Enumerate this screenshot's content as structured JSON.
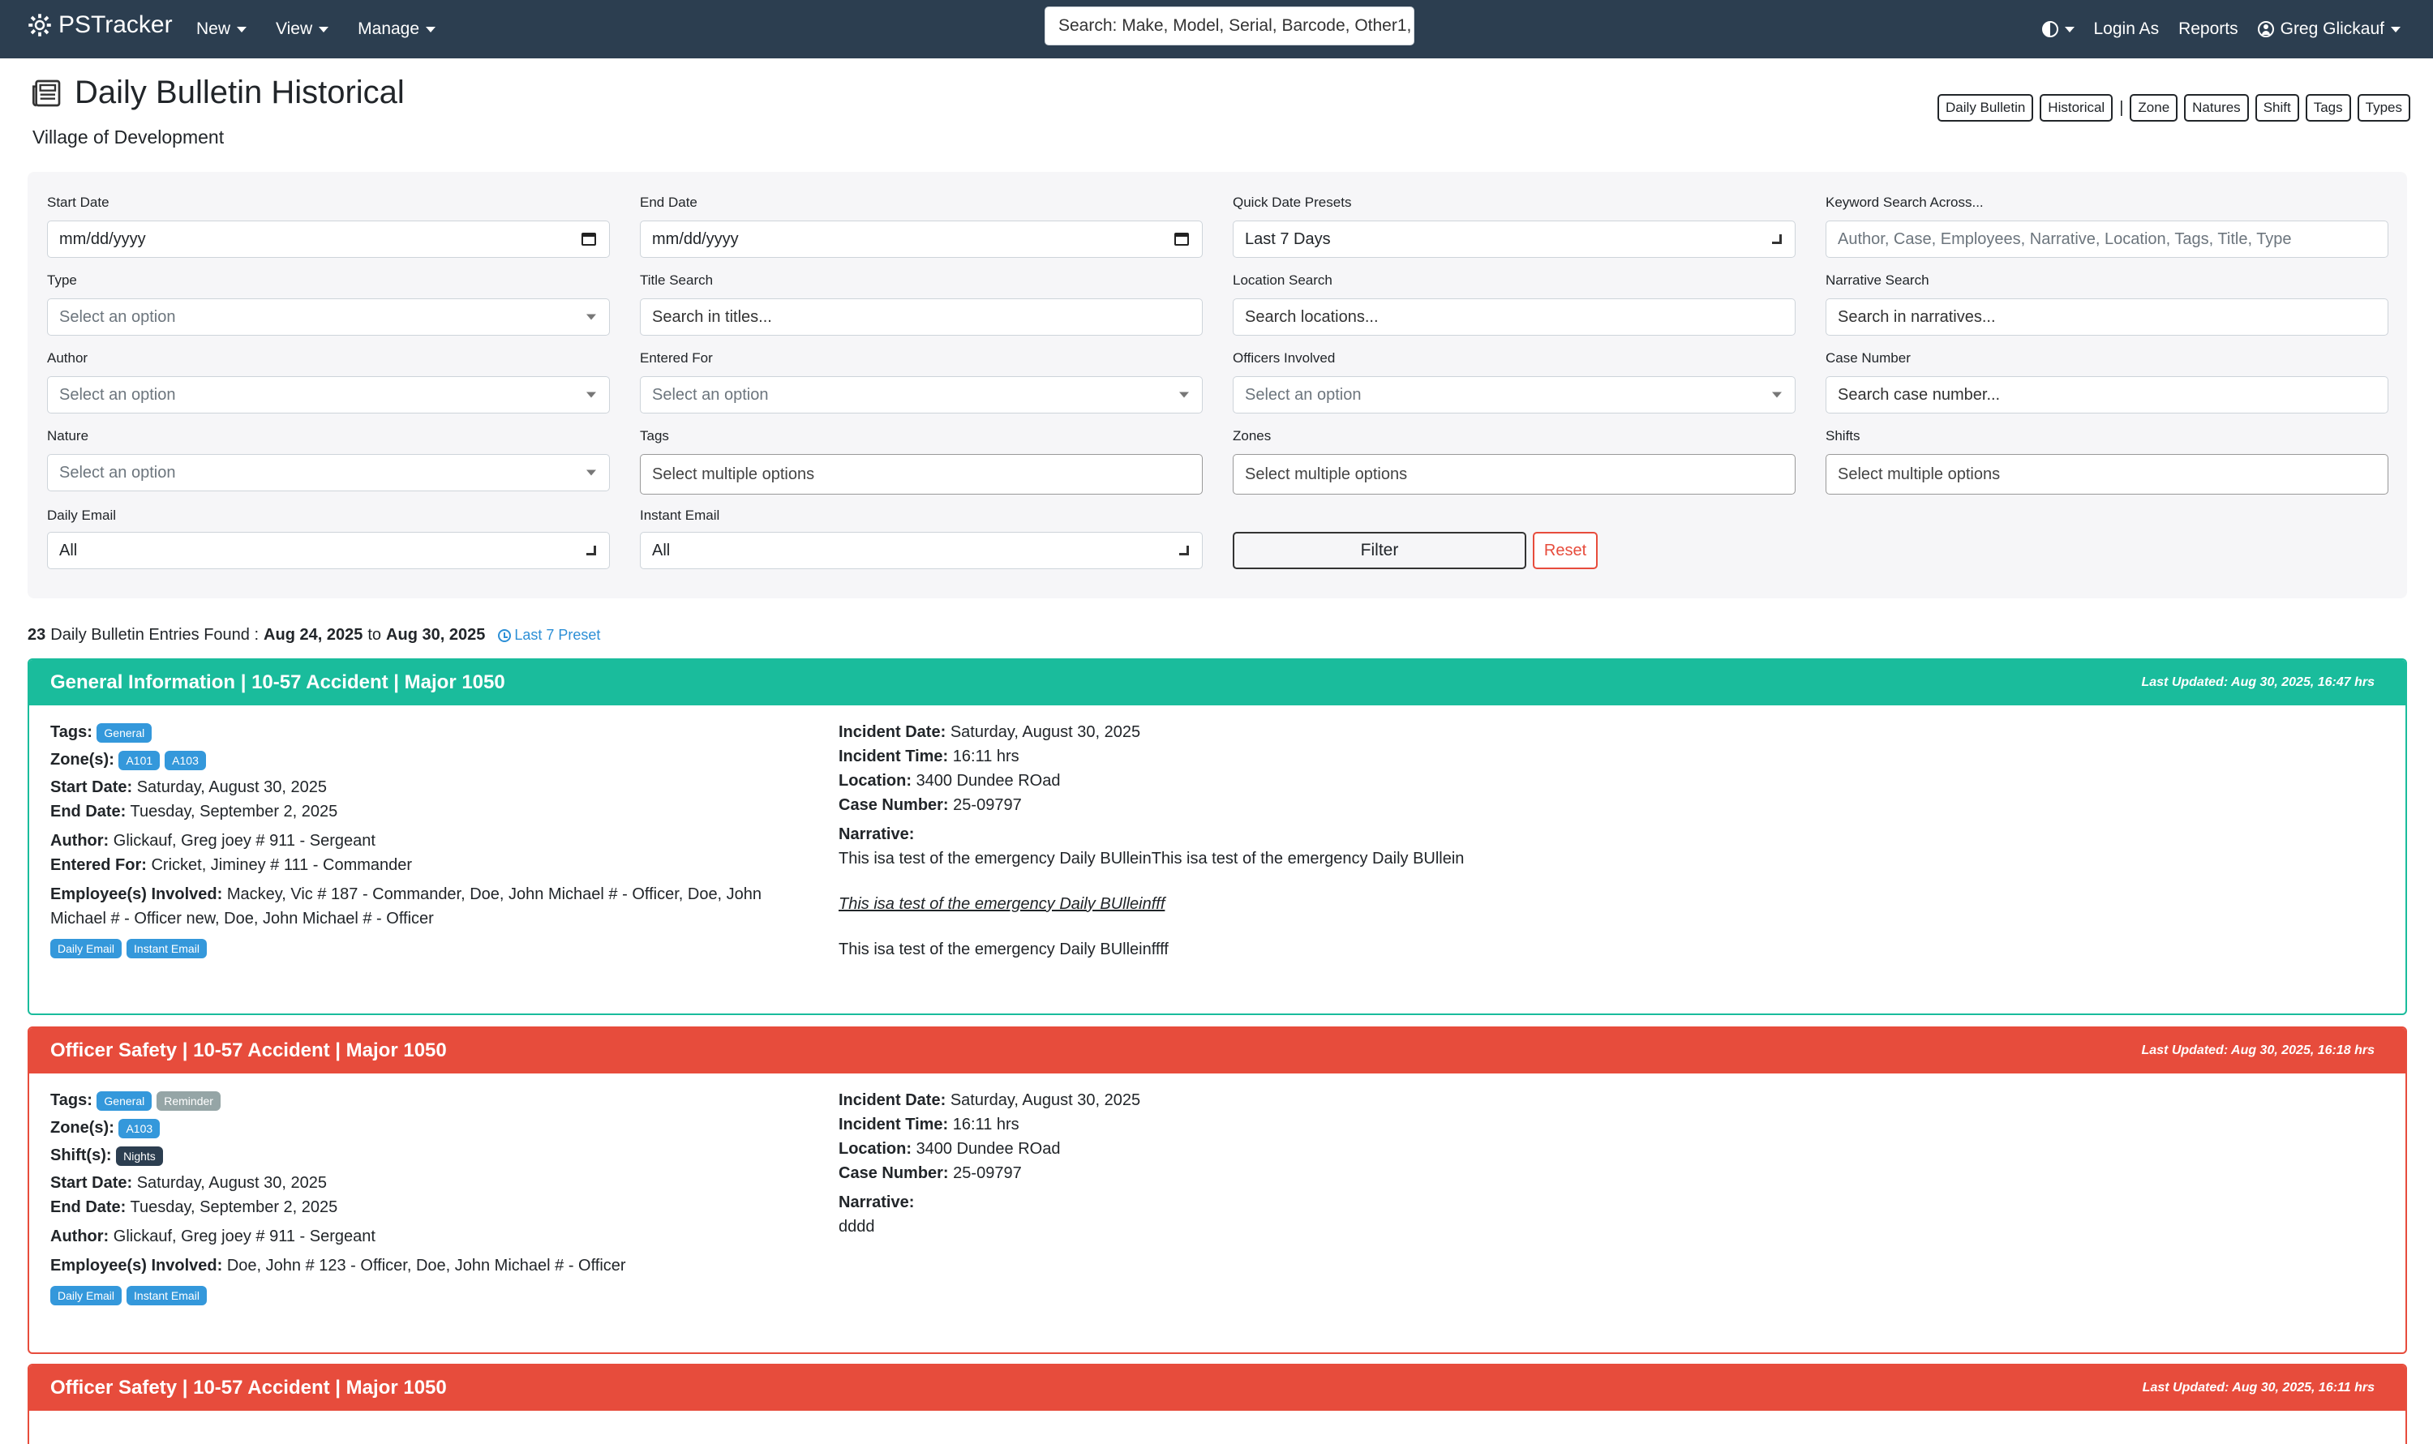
{
  "nav": {
    "brand": "PSTracker",
    "menus": [
      "New",
      "View",
      "Manage"
    ],
    "search_placeholder": "Search: Make, Model, Serial, Barcode, Other1,",
    "login_as": "Login As",
    "reports": "Reports",
    "user": "Greg Glickauf"
  },
  "page": {
    "title": "Daily Bulletin Historical",
    "subtitle": "Village of Development",
    "quick_links": [
      "Daily Bulletin",
      "Historical",
      "Zone",
      "Natures",
      "Shift",
      "Tags",
      "Types"
    ]
  },
  "filters": {
    "start_date": {
      "label": "Start Date",
      "value": "mm/dd/yyyy"
    },
    "end_date": {
      "label": "End Date",
      "value": "mm/dd/yyyy"
    },
    "presets": {
      "label": "Quick Date Presets",
      "value": "Last 7 Days"
    },
    "keyword": {
      "label": "Keyword Search Across...",
      "placeholder": "Author, Case, Employees, Narrative, Location, Tags, Title, Type"
    },
    "type": {
      "label": "Type",
      "placeholder": "Select an option"
    },
    "title_search": {
      "label": "Title Search",
      "placeholder": "Search in titles..."
    },
    "location_search": {
      "label": "Location Search",
      "placeholder": "Search locations..."
    },
    "narrative_search": {
      "label": "Narrative Search",
      "placeholder": "Search in narratives..."
    },
    "author": {
      "label": "Author",
      "placeholder": "Select an option"
    },
    "entered_for": {
      "label": "Entered For",
      "placeholder": "Select an option"
    },
    "officers": {
      "label": "Officers Involved",
      "placeholder": "Select an option"
    },
    "case_number": {
      "label": "Case Number",
      "placeholder": "Search case number..."
    },
    "nature": {
      "label": "Nature",
      "placeholder": "Select an option"
    },
    "tags": {
      "label": "Tags",
      "placeholder": "Select multiple options"
    },
    "zones": {
      "label": "Zones",
      "placeholder": "Select multiple options"
    },
    "shifts": {
      "label": "Shifts",
      "placeholder": "Select multiple options"
    },
    "daily_email": {
      "label": "Daily Email",
      "value": "All"
    },
    "instant_email": {
      "label": "Instant Email",
      "value": "All"
    },
    "filter_button": "Filter",
    "reset_button": "Reset"
  },
  "summary": {
    "count": "23",
    "text": "Daily Bulletin Entries Found :",
    "from": "Aug 24, 2025",
    "to_word": "to",
    "to": "Aug 30, 2025",
    "preset": "Last 7 Preset"
  },
  "labels": {
    "tags": "Tags:",
    "zones": "Zone(s):",
    "shifts": "Shift(s):",
    "start_date": "Start Date:",
    "end_date": "End Date:",
    "author": "Author:",
    "entered_for": "Entered For:",
    "employees": "Employee(s) Involved:",
    "incident_date": "Incident Date:",
    "incident_time": "Incident Time:",
    "location": "Location:",
    "case_number": "Case Number:",
    "narrative": "Narrative:"
  },
  "colors": {
    "navbar": "#2c3e50",
    "general": "#1abc9c",
    "officer_safety": "#e74c3c",
    "badge_blue": "#3498db",
    "badge_gray": "#95a5a6"
  },
  "entries": [
    {
      "title": "General Information | 10-57 Accident | Major 1050",
      "updated": "Last Updated: Aug 30, 2025, 16:47 hrs",
      "tags": [
        "General"
      ],
      "zones": [
        "A101",
        "A103"
      ],
      "start_date": "Saturday, August 30, 2025",
      "end_date": "Tuesday, September 2, 2025",
      "author": "Glickauf, Greg joey # 911 - Sergeant",
      "entered_for": "Cricket, Jiminey # 111 - Commander",
      "employees": "Mackey, Vic # 187 - Commander, Doe, John Michael # - Officer, Doe, John Michael # - Officer new, Doe, John Michael # - Officer",
      "emails": [
        "Daily Email",
        "Instant Email"
      ],
      "incident_date": "Saturday, August 30, 2025",
      "incident_time": "16:11 hrs",
      "location": "3400 Dundee ROad",
      "case_number": "25-09797",
      "narrative": [
        "This isa test of the emergency Daily BUlleinThis isa test of the emergency Daily BUllein",
        "This isa test of the emergency Daily BUlleinfff",
        "This isa test of the emergency Daily BUlleinffff"
      ]
    },
    {
      "title": "Officer Safety | 10-57 Accident | Major 1050",
      "updated": "Last Updated: Aug 30, 2025, 16:18 hrs",
      "tags": [
        "General",
        "Reminder"
      ],
      "zones": [
        "A103"
      ],
      "shifts": [
        "Nights"
      ],
      "start_date": "Saturday, August 30, 2025",
      "end_date": "Tuesday, September 2, 2025",
      "author": "Glickauf, Greg joey # 911 - Sergeant",
      "employees": "Doe, John # 123 - Officer, Doe, John Michael # - Officer",
      "emails": [
        "Daily Email",
        "Instant Email"
      ],
      "incident_date": "Saturday, August 30, 2025",
      "incident_time": "16:11 hrs",
      "location": "3400 Dundee ROad",
      "case_number": "25-09797",
      "narrative": [
        "dddd"
      ]
    },
    {
      "title": "Officer Safety | 10-57 Accident | Major 1050",
      "updated": "Last Updated: Aug 30, 2025, 16:11 hrs"
    }
  ]
}
